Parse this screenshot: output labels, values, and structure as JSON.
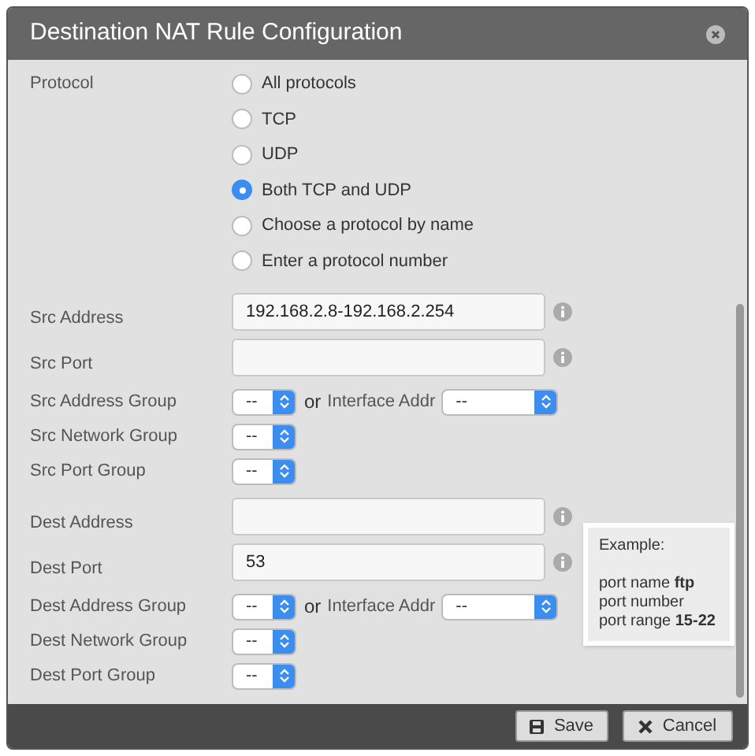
{
  "dialog": {
    "title": "Destination NAT Rule Configuration",
    "protocol": {
      "label": "Protocol",
      "options": [
        {
          "label": "All protocols",
          "selected": false
        },
        {
          "label": "TCP",
          "selected": false
        },
        {
          "label": "UDP",
          "selected": false
        },
        {
          "label": "Both TCP and UDP",
          "selected": true
        },
        {
          "label": "Choose a protocol by name",
          "selected": false
        },
        {
          "label": "Enter a protocol number",
          "selected": false
        }
      ]
    },
    "groups": [
      [
        {
          "kind": "text",
          "label": "Src Address",
          "value": "192.168.2.8-192.168.2.254",
          "info": true
        },
        {
          "kind": "text",
          "label": "Src Port",
          "info": true
        },
        {
          "kind": "select",
          "label": "Src Address Group",
          "value": "--",
          "extra": {
            "connector": "or",
            "label": "Interface Addr",
            "value": "--"
          }
        },
        {
          "kind": "select",
          "label": "Src Network Group",
          "value": "--"
        },
        {
          "kind": "select",
          "label": "Src Port Group",
          "value": "--"
        }
      ],
      [
        {
          "kind": "text",
          "label": "Dest Address",
          "info": true
        },
        {
          "kind": "text",
          "label": "Dest Port",
          "value": "53",
          "info": true
        },
        {
          "kind": "select",
          "label": "Dest Address Group",
          "value": "--",
          "extra": {
            "connector": "or",
            "label": "Interface Addr",
            "value": "--"
          }
        },
        {
          "kind": "select",
          "label": "Dest Network Group",
          "value": "--"
        },
        {
          "kind": "select",
          "label": "Dest Port Group",
          "value": "--"
        }
      ]
    ],
    "tooltip": {
      "title": "Example:",
      "lines": [
        "port name **ftp**",
        "port number",
        "port range **15-22**"
      ]
    },
    "buttons": [
      {
        "kind": "save",
        "label": "Save"
      },
      {
        "kind": "cancel",
        "label": "Cancel"
      }
    ]
  }
}
